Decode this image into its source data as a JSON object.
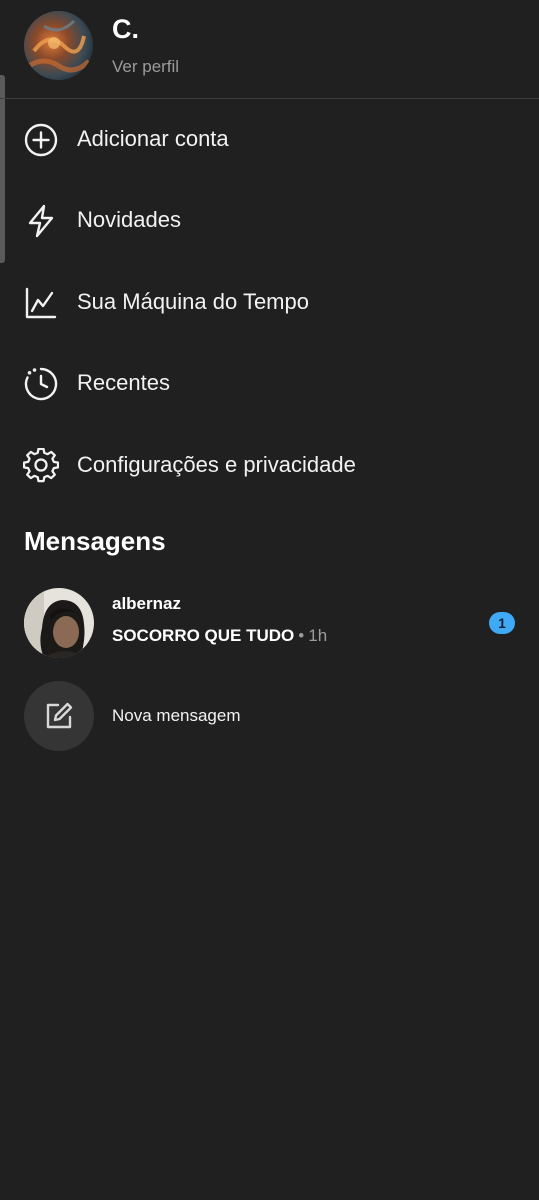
{
  "profile": {
    "name": "C.",
    "link_label": "Ver perfil"
  },
  "menu": {
    "items": [
      {
        "label": "Adicionar conta",
        "icon": "add-circle-icon"
      },
      {
        "label": "Novidades",
        "icon": "lightning-icon"
      },
      {
        "label": "Sua Máquina do Tempo",
        "icon": "trend-chart-icon"
      },
      {
        "label": "Recentes",
        "icon": "history-clock-icon"
      },
      {
        "label": "Configurações e privacidade",
        "icon": "gear-icon"
      }
    ]
  },
  "messages": {
    "title": "Mensagens",
    "conversations": [
      {
        "name": "albernaz",
        "preview": "SOCORRO QUE TUDO",
        "separator": "•",
        "time": "1h",
        "unread": "1"
      }
    ],
    "new_message_label": "Nova mensagem",
    "new_message_icon": "compose-icon"
  },
  "colors": {
    "background": "#202020",
    "badge": "#3fa9f5",
    "secondary_text": "#9b9b9b"
  }
}
